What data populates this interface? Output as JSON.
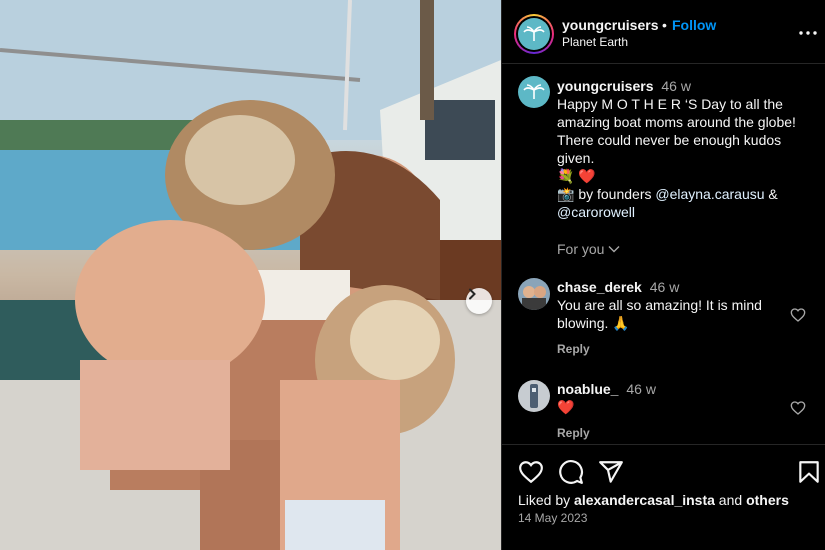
{
  "header": {
    "username": "youngcruisers",
    "separator": "•",
    "follow_label": "Follow",
    "location": "Planet Earth"
  },
  "caption": {
    "username": "youngcruisers",
    "time": "46 w",
    "text_line1": "Happy M O T H E R ‘S Day to all the amazing boat moms around the globe! There could never be enough kudos given.",
    "emoji_line": "💐 ❤️",
    "credit_prefix": "📸 by founders ",
    "mention1": "@elayna.carausu",
    "credit_join": " & ",
    "mention2": "@carorowell",
    "for_you_label": "For you"
  },
  "comments": [
    {
      "username": "chase_derek",
      "time": "46 w",
      "text": "You are all so amazing! It is mind blowing. 🙏",
      "reply_label": "Reply"
    },
    {
      "username": "noablue_",
      "time": "46 w",
      "text": "❤️",
      "reply_label": "Reply"
    }
  ],
  "footer": {
    "liked_prefix": "Liked by ",
    "liked_user": "alexandercasal_insta",
    "liked_and": " and ",
    "liked_others": "others",
    "date": "14 May 2023"
  },
  "colors": {
    "accent": "#0095f6",
    "brand_teal": "#5db8c6",
    "muted": "#a8a8a8"
  },
  "icons": [
    "more-icon",
    "chevron-right-icon",
    "chevron-down-icon",
    "heart-icon",
    "comment-icon",
    "share-icon",
    "bookmark-icon"
  ]
}
